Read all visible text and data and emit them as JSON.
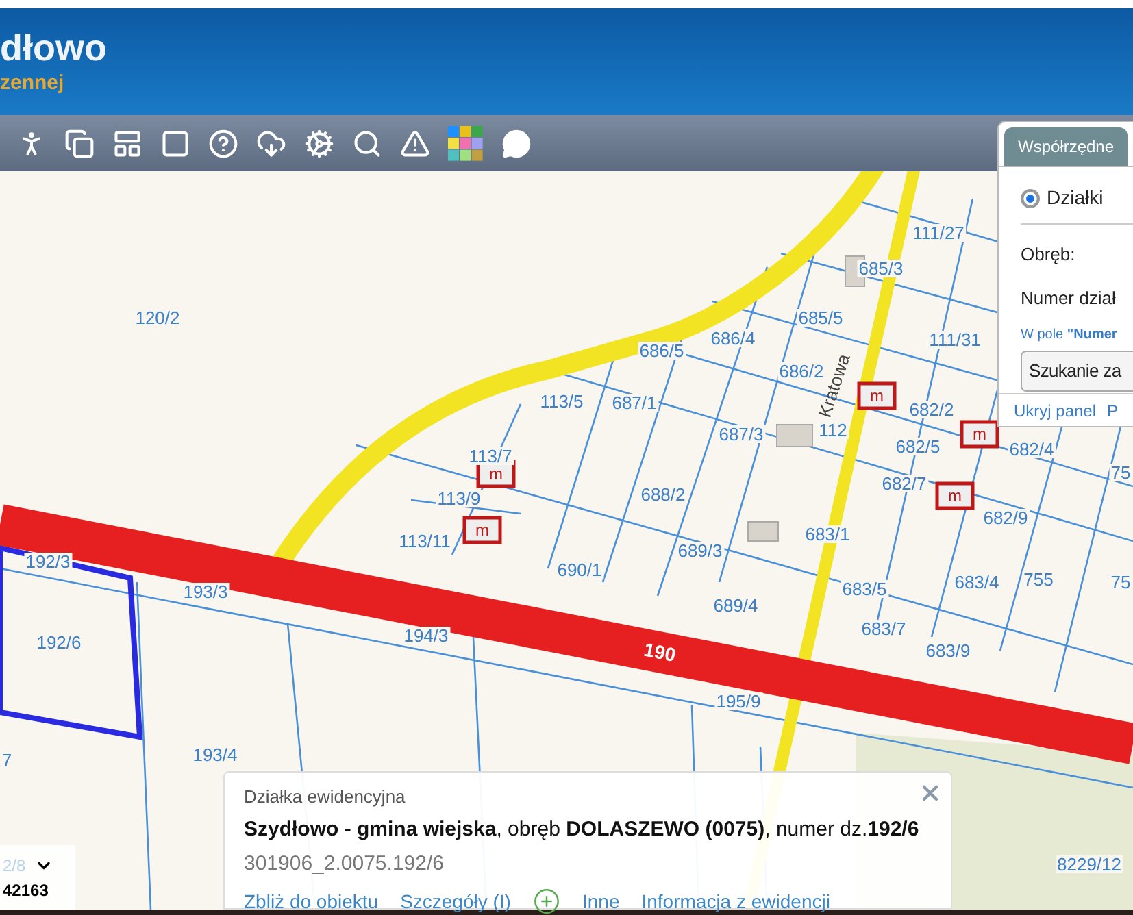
{
  "header": {
    "title": "dłowo",
    "subtitle": "zennej"
  },
  "map": {
    "parcel_labels": [
      "120/2",
      "686/5",
      "686/4",
      "685/5",
      "686/2",
      "111/27",
      "685/3",
      "111/31",
      "113/5",
      "687/1",
      "687/3",
      "112",
      "682/2",
      "682/5",
      "682/7",
      "682/4",
      "682/9",
      "113/7",
      "113/9",
      "113/11",
      "688/2",
      "683/1",
      "690/1",
      "689/3",
      "689/4",
      "683/5",
      "683/4",
      "755",
      "683/7",
      "683/9",
      "193/3",
      "192/3",
      "192/6",
      "194/3",
      "195/9",
      "193/4",
      "8229/12",
      "75",
      "75",
      "7"
    ],
    "road_number": "190",
    "street_name": "Kratowa",
    "building_labels": [
      "m",
      "m",
      "m",
      "m",
      "m"
    ]
  },
  "coordinate_box": {
    "label": "2/8",
    "value": "42163"
  },
  "search_panel": {
    "tabs": [
      {
        "label": "Współrzędne",
        "selected": false
      }
    ],
    "options": [
      {
        "label": "Działki",
        "selected": true
      }
    ],
    "fields": [
      {
        "label": "Obręb:"
      },
      {
        "label": "Numer dział"
      }
    ],
    "hint": "W pole **\"Numer**",
    "button": "Szukanie za",
    "links": [
      "Ukryj panel",
      "P"
    ]
  },
  "popup": {
    "title": "Działka ewidencyjna",
    "description": "**Szydłowo - gmina wiejska**, obręb **DOLASZEWO (0075)**, numer dz.**192/6**",
    "identifier": "301906_2.0075.192/6",
    "links": [
      "Zbliż do obiektu",
      "Szczegóły (I)",
      "Inne",
      "Informacja z ewidencji"
    ]
  }
}
